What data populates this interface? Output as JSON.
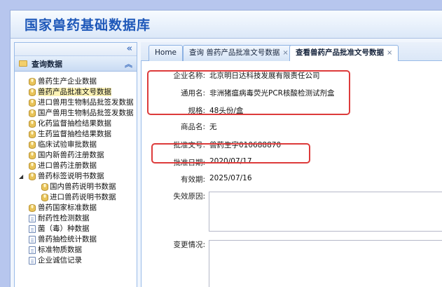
{
  "app": {
    "title": "国家兽药基础数据库"
  },
  "sidebar": {
    "collapse_icon": "«",
    "section_label": "查询数据",
    "section_toggle_icon": "︽",
    "items": [
      {
        "label": "兽药生产企业数据",
        "icon": "database-icon",
        "level": 1
      },
      {
        "label": "兽药产品批准文号数据",
        "icon": "database-icon",
        "level": 1,
        "selected": true
      },
      {
        "label": "进口兽用生物制品批签发数据",
        "icon": "database-icon",
        "level": 1
      },
      {
        "label": "国产兽用生物制品批签发数据",
        "icon": "database-icon",
        "level": 1
      },
      {
        "label": "化药监督抽检结果数据",
        "icon": "database-icon",
        "level": 1
      },
      {
        "label": "生药监督抽检结果数据",
        "icon": "database-icon",
        "level": 1
      },
      {
        "label": "临床试验审批数据",
        "icon": "database-icon",
        "level": 1
      },
      {
        "label": "国内新兽药注册数据",
        "icon": "database-icon",
        "level": 1
      },
      {
        "label": "进口兽药注册数据",
        "icon": "database-icon",
        "level": 1
      },
      {
        "label": "兽药标签说明书数据",
        "icon": "database-icon",
        "level": 1,
        "expanded": true
      },
      {
        "label": "国内兽药说明书数据",
        "icon": "database-icon",
        "level": 2
      },
      {
        "label": "进口兽药说明书数据",
        "icon": "database-icon",
        "level": 2
      },
      {
        "label": "兽药国家标准数据",
        "icon": "database-icon",
        "level": 1
      },
      {
        "label": "耐药性检测数据",
        "icon": "page-icon",
        "level": 1
      },
      {
        "label": "菌（毒）种数据",
        "icon": "page-icon",
        "level": 1
      },
      {
        "label": "兽药抽检统计数据",
        "icon": "page-icon",
        "level": 1
      },
      {
        "label": "标准物质数据",
        "icon": "page-icon",
        "level": 1
      },
      {
        "label": "企业诚信记录",
        "icon": "page-icon",
        "level": 1
      }
    ]
  },
  "tabs": [
    {
      "label": "Home",
      "closable": false,
      "active": false
    },
    {
      "label": "查询 兽药产品批准文号数据",
      "closable": true,
      "active": false
    },
    {
      "label": "查看兽药产品批准文号数据",
      "closable": true,
      "active": true
    }
  ],
  "tab_close_icon": "×",
  "detail": {
    "company_label": "企业名称:",
    "company_value": "北京明日达科技发展有限责任公司",
    "generic_label": "通用名:",
    "generic_value": "非洲猪瘟病毒荧光PCR核酸检测试剂盒",
    "spec_label": "规格:",
    "spec_value": "48头份/盒",
    "trade_label": "商品名:",
    "trade_value": "无",
    "approval_no_label": "批准文号:",
    "approval_no_value": "兽药生字010688870",
    "approval_date_label": "批准日期:",
    "approval_date_value": "2020/07/17",
    "valid_label": "有效期:",
    "valid_value": "2025/07/16",
    "invalid_reason_label": "失效原因:",
    "invalid_reason_value": "",
    "change_label": "变更情况:",
    "change_value": ""
  },
  "colors": {
    "title": "#1e58b9",
    "highlight": "#dd3b3b",
    "selected_bg": "#fbf2b4",
    "border": "#99bbe8"
  }
}
